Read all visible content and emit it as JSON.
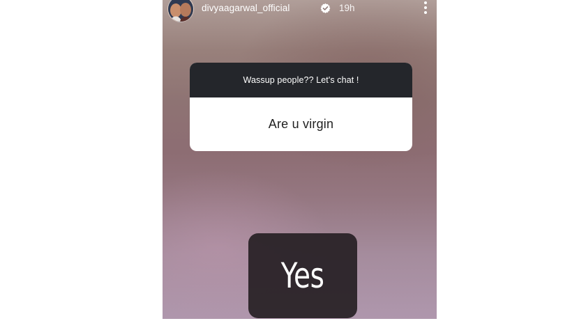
{
  "story": {
    "username": "divyaagarwal_official",
    "timestamp": "19h",
    "verified": true
  },
  "question_sticker": {
    "prompt": "Wassup people?? Let's chat !",
    "question": "Are u virgin"
  },
  "answer": {
    "text": "Yes"
  },
  "colors": {
    "sticker_header": "#24262b",
    "sticker_body": "#ffffff",
    "answer_box": "#262024"
  },
  "icons": [
    "avatar",
    "verified-badge-icon",
    "more-options-icon"
  ]
}
